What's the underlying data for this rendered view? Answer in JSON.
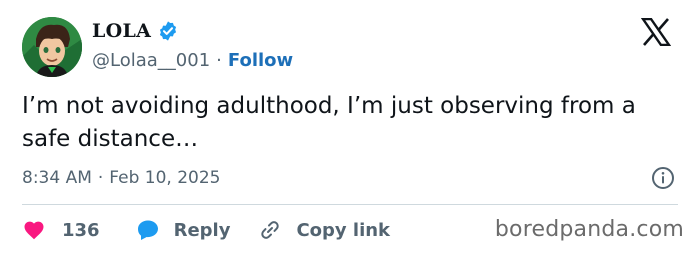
{
  "author": {
    "display_name": "LOLA",
    "handle": "@Lolaa__001",
    "separator": "·",
    "follow_label": "Follow",
    "verified": true
  },
  "tweet": {
    "text": "I’m not avoiding adulthood, I’m just observing from a safe distance…",
    "time": "8:34 AM",
    "separator": "·",
    "date": "Feb 10, 2025"
  },
  "actions": {
    "like_count": "136",
    "reply_label": "Reply",
    "copy_label": "Copy link"
  },
  "watermark": "boredpanda.com",
  "colors": {
    "accent": "#1d9bf0",
    "follow": "#1d6fb8",
    "like": "#f91880",
    "muted": "#536471",
    "text": "#0f1419"
  }
}
